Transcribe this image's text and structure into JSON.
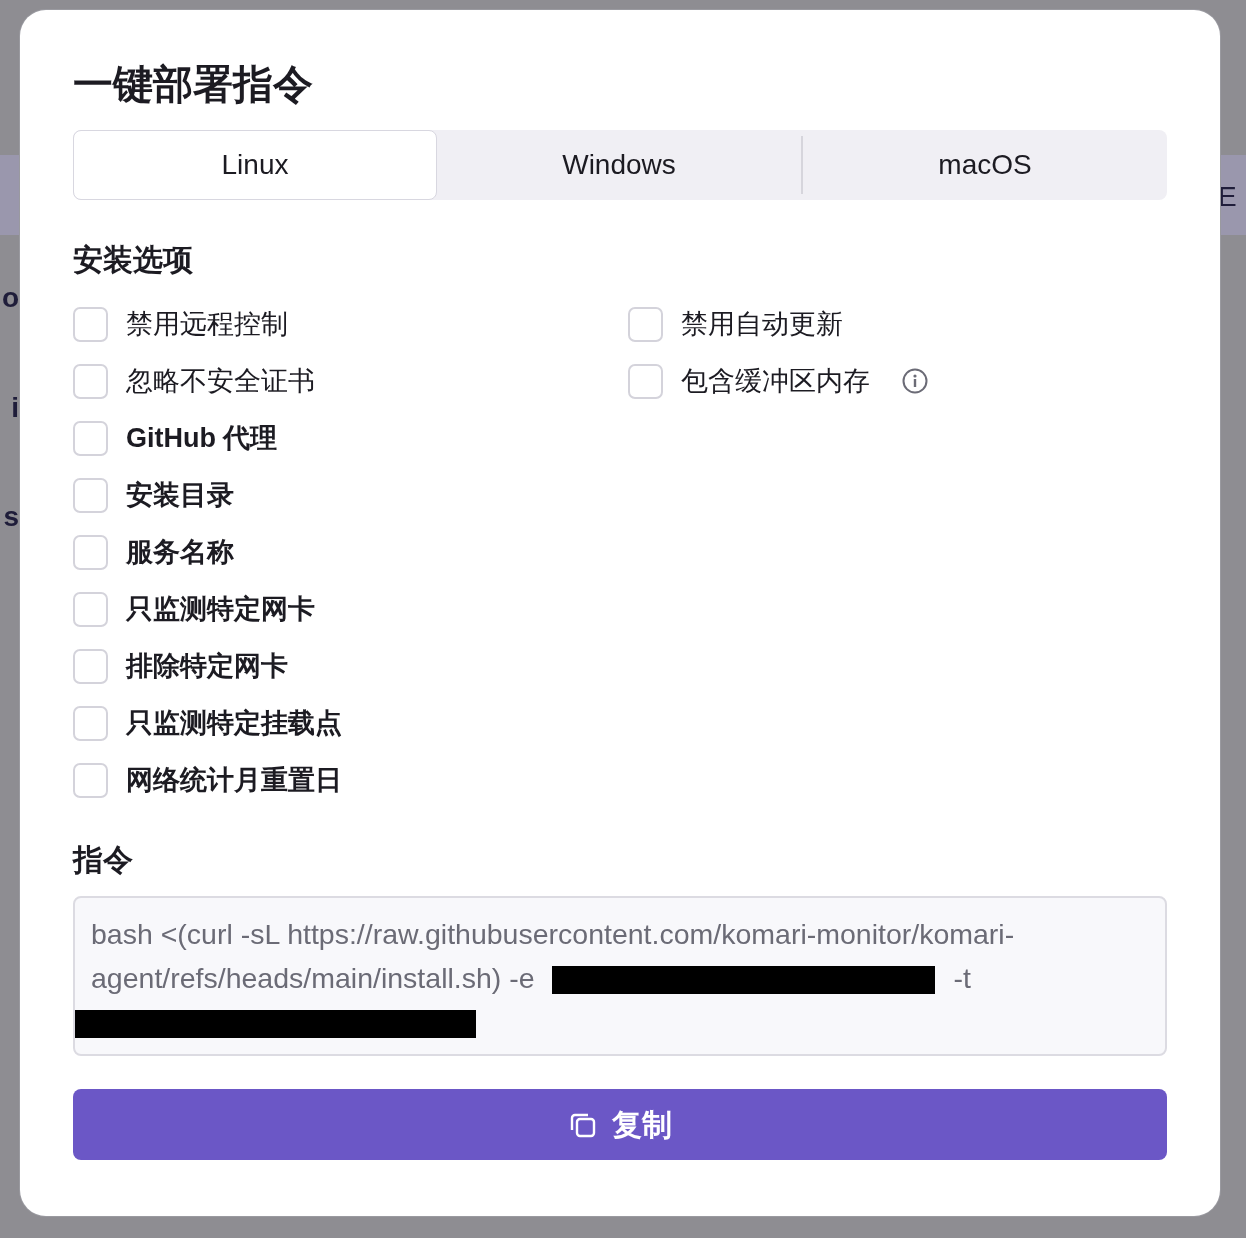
{
  "background": {
    "left_texts": [
      "o",
      "i",
      "s"
    ],
    "right_texts": [
      "E"
    ]
  },
  "dialog": {
    "title": "一键部署指令",
    "tabs": [
      {
        "label": "Linux",
        "selected": true
      },
      {
        "label": "Windows",
        "selected": false
      },
      {
        "label": "macOS",
        "selected": false
      }
    ],
    "options_heading": "安装选项",
    "options": [
      {
        "label": "禁用远程控制",
        "checked": false,
        "emphasized": false,
        "info": false
      },
      {
        "label": "禁用自动更新",
        "checked": false,
        "emphasized": false,
        "info": false
      },
      {
        "label": "忽略不安全证书",
        "checked": false,
        "emphasized": false,
        "info": false
      },
      {
        "label": "包含缓冲区内存",
        "checked": false,
        "emphasized": false,
        "info": true
      },
      {
        "label": "GitHub 代理",
        "checked": false,
        "emphasized": true,
        "info": false
      },
      {
        "label": "安装目录",
        "checked": false,
        "emphasized": true,
        "info": false
      },
      {
        "label": "服务名称",
        "checked": false,
        "emphasized": true,
        "info": false
      },
      {
        "label": "只监测特定网卡",
        "checked": false,
        "emphasized": true,
        "info": false
      },
      {
        "label": "排除特定网卡",
        "checked": false,
        "emphasized": true,
        "info": false
      },
      {
        "label": "只监测特定挂载点",
        "checked": false,
        "emphasized": true,
        "info": false
      },
      {
        "label": "网络统计月重置日",
        "checked": false,
        "emphasized": true,
        "info": false
      }
    ],
    "command_heading": "指令",
    "command": [
      {
        "kind": "text",
        "text": "bash <(curl -sL https://raw.githubusercontent.com/komari-monitor/komari-agent/refs/heads/main/install.sh) -e"
      },
      {
        "kind": "redacted"
      },
      {
        "kind": "text",
        "text": "-t"
      },
      {
        "kind": "redacted"
      }
    ],
    "copy_button": "复制"
  }
}
